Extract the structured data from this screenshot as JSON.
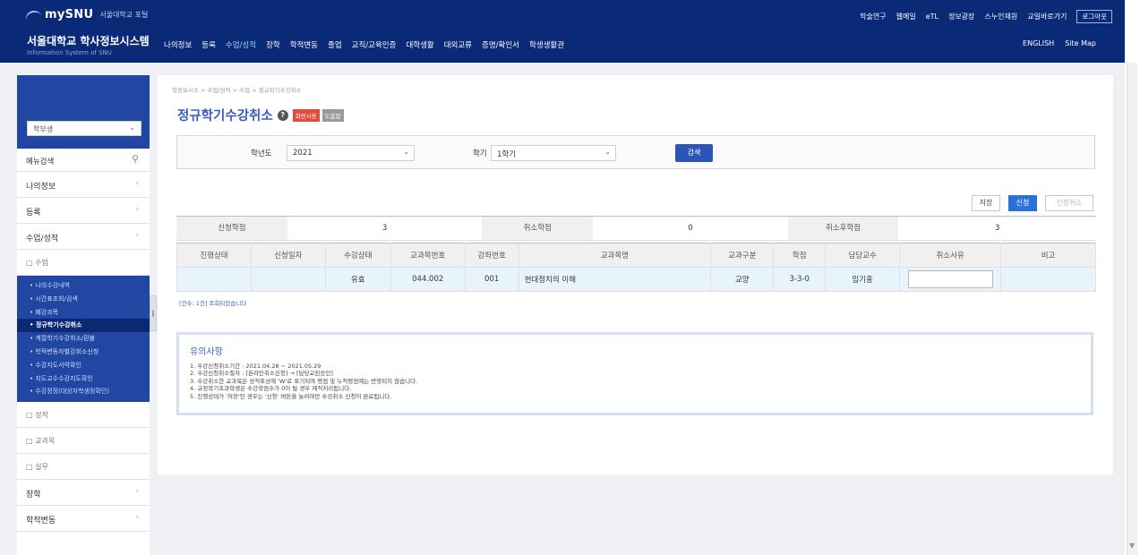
{
  "header": {
    "logo_text": "mySNU",
    "logo_sub": "서울대학교 포털",
    "system_title": "서울대학교 학사정보시스템",
    "system_subtitle": "Information System of SNU",
    "nav": [
      "나의정보",
      "등록",
      "수업/성적",
      "장학",
      "학적변동",
      "졸업",
      "교직/교육인증",
      "대학생활",
      "대외교류",
      "증명/확인서",
      "학생생활관"
    ],
    "nav_active_index": 2,
    "util": [
      "학술연구",
      "웹메일",
      "eTL",
      "정보광장",
      "스누인재원",
      "교일바로가기"
    ],
    "logout_label": "로그아웃",
    "lang": [
      "ENGLISH",
      "Site Map"
    ]
  },
  "sidebar": {
    "select_value": "학부생",
    "search_label": "메뉴검색",
    "items_top": [
      {
        "label": "나의정보"
      },
      {
        "label": "등록"
      },
      {
        "label": "수업/성적"
      }
    ],
    "sub_header": "수업",
    "submenu": [
      "나의수강내역",
      "시간표조회/검색",
      "폐강과목",
      "정규학기수강취소",
      "계절학기수강취소/환불",
      "학적변동자별강취소신청",
      "수강지도서약확인",
      "지도교수수강지도확인",
      "수강정정(대상자학생정확인)"
    ],
    "submenu_active_index": 3,
    "items_bottom_sub": [
      "성적",
      "교과목",
      "실무"
    ],
    "items_bottom": [
      {
        "label": "장학"
      },
      {
        "label": "학적변동"
      }
    ]
  },
  "main": {
    "breadcrumb": "학정보시스 > 수업/성적 > 수업 > 정규학기수강취소",
    "title": "정규학기수강취소",
    "badge_red": "화면사용",
    "badge_gray": "도움말",
    "filter": {
      "year_label": "학년도",
      "year_value": "2021",
      "term_label": "학기",
      "term_value": "1학기",
      "search_button": "검색"
    },
    "actions": {
      "save": "저장",
      "apply": "신청",
      "cancel_apply": "신청취소"
    },
    "summary": {
      "applied_credits_label": "신청학점",
      "applied_credits_value": "3",
      "cancel_credits_label": "취소학점",
      "cancel_credits_value": "0",
      "after_cancel_label": "취소후학점",
      "after_cancel_value": "3"
    },
    "table": {
      "columns": [
        "진행상태",
        "신청일자",
        "수강상태",
        "교과목번호",
        "강좌번호",
        "교과목명",
        "교과구분",
        "학점",
        "담당교수",
        "취소사유",
        "비고"
      ],
      "rows": [
        {
          "status": "",
          "date": "",
          "enroll": "유효",
          "course_no": "044.002",
          "section": "001",
          "name": "현대정치의 이해",
          "category": "교양",
          "credits": "3-3-0",
          "professor": "임기홍",
          "reason": "",
          "remark": ""
        }
      ]
    },
    "table_note": "[건수: 1건] 조회되었습니다",
    "notice": {
      "title": "유의사항",
      "lines": [
        "1. 수강신청취소기간 : 2021.04.28 ~ 2021.05.29",
        "2. 수강신청취소절차 : [온라인취소신청] → [담당교원승인]",
        "3. 수강취소한 교과목은 성적표상에 'W'로 표기되며 평점 및 누적평점에는 반영되지 않습니다.",
        "4. 규정학기초과학생은 수강학점수가 0이 될 경우 제적처리됩니다.",
        "5. 진행상태가 '저장'인 경우는 '신청' 버튼을 눌러야만 수강취소 신청이 완료됩니다."
      ]
    }
  }
}
